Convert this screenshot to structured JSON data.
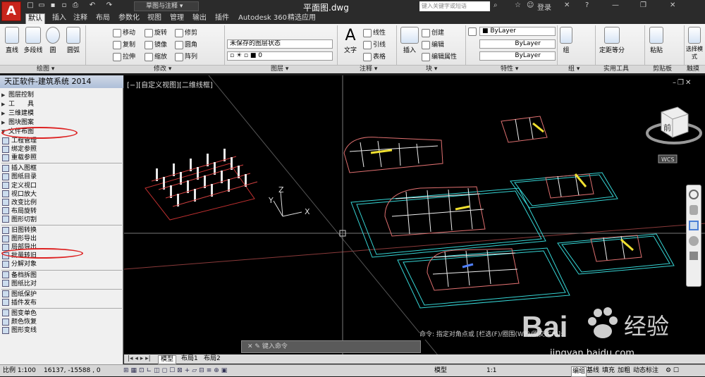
{
  "titlebar": {
    "app_letter": "A",
    "workspace": "草图与注释",
    "doc_title": "平面图.dwg",
    "search_placeholder": "键入关键字或短语",
    "login": "登录"
  },
  "tabs": [
    "默认",
    "插入",
    "注释",
    "布局",
    "参数化",
    "视图",
    "管理",
    "输出",
    "插件",
    "Autodesk 360",
    "精选应用"
  ],
  "ribbon": {
    "draw": {
      "line": "直线",
      "polyline": "多段线",
      "circle": "圆",
      "arc": "圆弧",
      "label": "绘图 ▾"
    },
    "modify": {
      "move": "移动",
      "rotate": "旋转",
      "trim": "修剪",
      "copy": "复制",
      "mirror": "镜像",
      "fillet": "圆角",
      "stretch": "拉伸",
      "scale": "缩放",
      "array": "阵列",
      "label": "修改 ▾"
    },
    "layers": {
      "layer_state": "未保存的图层状态",
      "layer_current": "0",
      "label": "图层 ▾"
    },
    "annotation": {
      "text": "文字",
      "linear": "线性",
      "leader": "引线",
      "table": "表格",
      "label": "注释 ▾"
    },
    "block": {
      "insert": "插入",
      "create": "创建",
      "edit": "编辑",
      "edit_attr": "编辑属性",
      "label": "块 ▾"
    },
    "properties": {
      "color": "ByLayer",
      "linetype": "ByLayer",
      "lineweight": "ByLayer",
      "label": "特性 ▾"
    },
    "group": {
      "group": "组",
      "label": "组 ▾"
    },
    "utilities": {
      "measure": "定距等分",
      "label": "实用工具"
    },
    "clipboard": {
      "paste": "粘贴",
      "label": "剪贴板"
    },
    "touch": {
      "select_mode": "选择模式",
      "label": "触摸"
    }
  },
  "palette": {
    "title": "天正软件-建筑系统 2014",
    "groups": [
      "图层控制",
      "工　　具",
      "三维建模",
      "图块图案",
      "文件布图"
    ],
    "items": [
      "工程管理",
      "绑定参照",
      "重载参照",
      "插入图框",
      "图纸目录",
      "定义视口",
      "视口放大",
      "改变比例",
      "布局旋转",
      "图形切割",
      "旧图转换",
      "图形导出",
      "局部导出",
      "批量转旧",
      "分解对象",
      "备档拆图",
      "图纸比对",
      "图纸保护",
      "插件发布",
      "图变单色",
      "颜色恢复",
      "图形变线"
    ]
  },
  "viewport": {
    "label": "[−][自定义视图][二维线框]",
    "cube_face": "前",
    "wcs": "WCS",
    "ucs_x": "X",
    "ucs_y": "Y",
    "ucs_z": "Z",
    "command_history": "命令: 指定对角点或 [栏选(F)/圈围(WP)/圈交(CP)]:",
    "command_prompt": "键入命令"
  },
  "layout_tabs": [
    "模型",
    "布局1",
    "布局2"
  ],
  "status": {
    "scale": "比例 1:100",
    "coords": "16137, -15588 , 0",
    "model": "模型",
    "anno_scale": "1:1",
    "edit": "编组",
    "baseline": "基线",
    "fill": "填充",
    "bold": "加粗",
    "dyn": "动态标注"
  },
  "watermark": {
    "brand": "Bai",
    "brand2": "经验",
    "url": "jingyan.baidu.com"
  },
  "colors": {
    "accent": "#c8251c",
    "viewport_bg": "#000000",
    "cyan": "#36d6d6",
    "red": "#e03a3a",
    "yellow": "#f0e030"
  }
}
